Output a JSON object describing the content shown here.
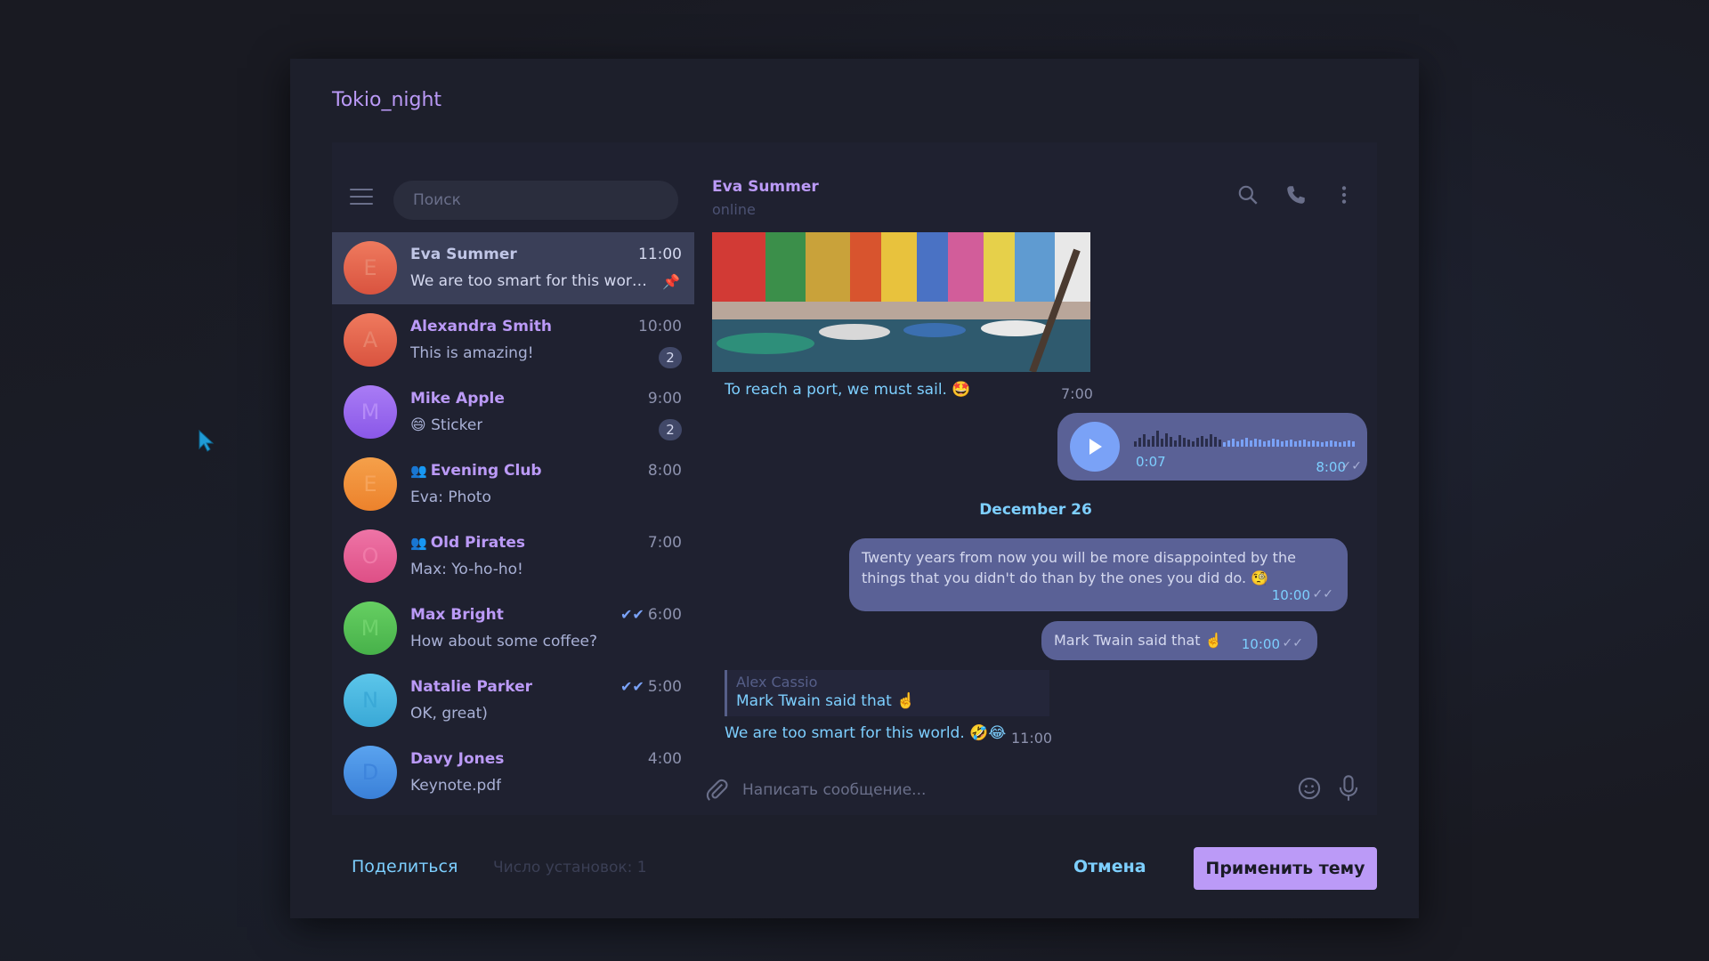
{
  "dialog": {
    "title": "Tokio_night",
    "share_label": "Поделиться",
    "installs_label": "Число установок: 1",
    "cancel_label": "Отмена",
    "apply_label": "Применить тему"
  },
  "sidebar": {
    "search_placeholder": "Поиск",
    "chats": [
      {
        "initial": "E",
        "name": "Eva Summer",
        "time": "11:00",
        "message": "We are too smart for this world. ...",
        "pinned": true,
        "avatar_color": "#e8664f"
      },
      {
        "initial": "A",
        "name": "Alexandra Smith",
        "time": "10:00",
        "message": "This is amazing!",
        "badge": "2",
        "avatar_color": "#e8664f"
      },
      {
        "initial": "M",
        "name": "Mike Apple",
        "time": "9:00",
        "message": "😄 Sticker",
        "badge": "2",
        "avatar_color": "#9b6cf0"
      },
      {
        "initial": "E",
        "name": "Evening Club",
        "time": "8:00",
        "message": "Eva: Photo",
        "group": true,
        "avatar_color": "#f39138"
      },
      {
        "initial": "O",
        "name": "Old Pirates",
        "time": "7:00",
        "message": "Max: Yo-ho-ho!",
        "group": true,
        "avatar_color": "#e66497"
      },
      {
        "initial": "M",
        "name": "Max Bright",
        "time": "6:00",
        "message": "How about some coffee?",
        "read": true,
        "avatar_color": "#57c45a"
      },
      {
        "initial": "N",
        "name": "Natalie Parker",
        "time": "5:00",
        "message": "OK, great)",
        "read": true,
        "avatar_color": "#45b7e0"
      },
      {
        "initial": "D",
        "name": "Davy Jones",
        "time": "4:00",
        "message": "Keynote.pdf",
        "avatar_color": "#4a90e2"
      }
    ]
  },
  "chat": {
    "peer_name": "Eva Summer",
    "peer_status": "online",
    "photo_caption": "To reach a port, we must sail. 🤩",
    "photo_time": "7:00",
    "voice_duration": "0:07",
    "voice_time": "8:00",
    "date_separator": "December 26",
    "msg1_text": "Twenty years from now you will be more disappointed by the things that you didn't do than by the ones you did do. 🧐",
    "msg1_time": "10:00",
    "msg2_text": "Mark Twain said that ☝️",
    "msg2_time": "10:00",
    "reply_from": "Alex Cassio",
    "reply_quote": "Mark Twain said that ☝️",
    "reply_text": "We are too smart for this world. 🤣😂",
    "reply_time": "11:00",
    "composer_placeholder": "Написать сообщение..."
  },
  "colors": {
    "accent": "#bb9af7",
    "link": "#7dcfff",
    "bubble_out": "#5a6196",
    "active_chat": "#3a3f58"
  }
}
